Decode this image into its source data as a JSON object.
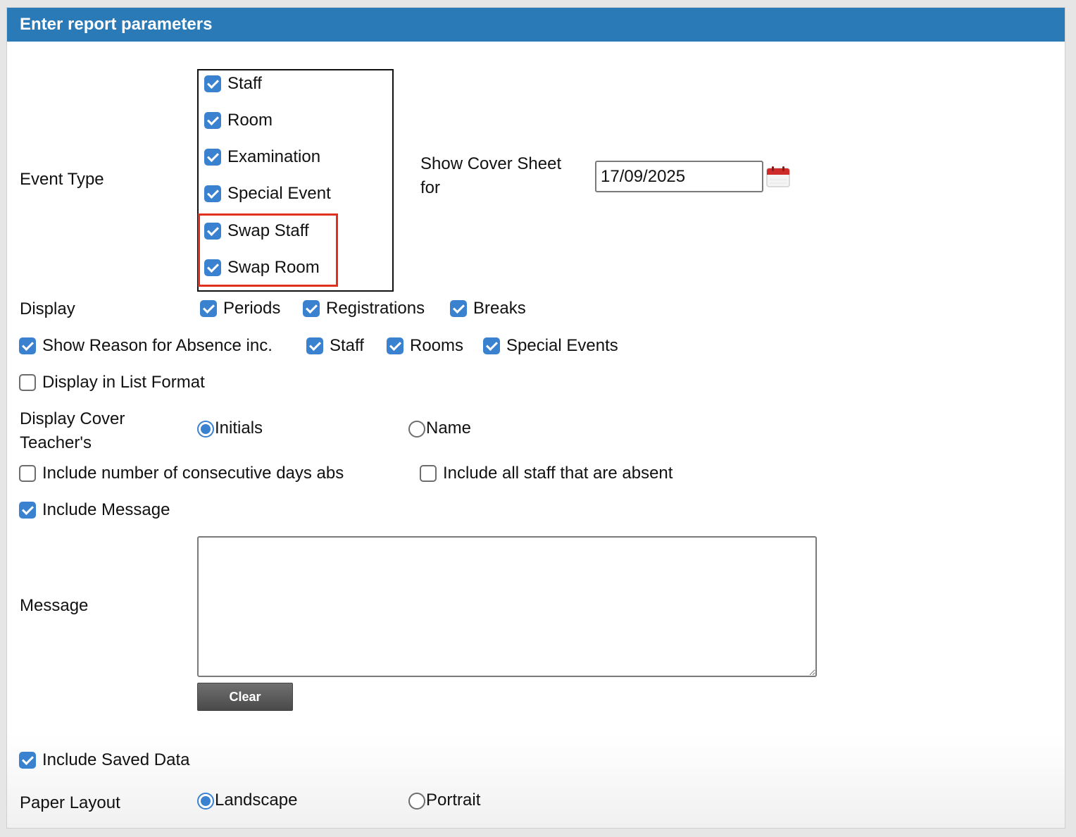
{
  "header": {
    "title": "Enter report parameters"
  },
  "event_type": {
    "label": "Event Type",
    "options": [
      {
        "label": "Staff",
        "checked": true
      },
      {
        "label": "Room",
        "checked": true
      },
      {
        "label": "Examination",
        "checked": true
      },
      {
        "label": "Special Event",
        "checked": true
      },
      {
        "label": "Swap Staff",
        "checked": true
      },
      {
        "label": "Swap Room",
        "checked": true
      }
    ]
  },
  "cover_sheet": {
    "label": "Show Cover Sheet for",
    "label_line1": "Show Cover Sheet",
    "label_line2": "for",
    "date": "17/09/2025"
  },
  "display": {
    "label": "Display",
    "options": [
      {
        "label": "Periods",
        "checked": true
      },
      {
        "label": "Registrations",
        "checked": true
      },
      {
        "label": "Breaks",
        "checked": true
      }
    ]
  },
  "absence": {
    "label": "Show Reason for Absence inc.",
    "checked": true,
    "options": [
      {
        "label": "Staff",
        "checked": true
      },
      {
        "label": "Rooms",
        "checked": true
      },
      {
        "label": "Special Events",
        "checked": true
      }
    ]
  },
  "list_format": {
    "label": "Display in List Format",
    "checked": false
  },
  "cover_teacher": {
    "label_line1": "Display Cover",
    "label_line2": "Teacher's",
    "options": [
      {
        "label": "Initials",
        "selected": true
      },
      {
        "label": "Name",
        "selected": false
      }
    ]
  },
  "consecutive_days": {
    "label": "Include number of consecutive days abs",
    "checked": false
  },
  "all_absent": {
    "label": "Include all staff that are absent",
    "checked": false
  },
  "include_message": {
    "label": "Include Message",
    "checked": true
  },
  "message": {
    "label": "Message",
    "value": ""
  },
  "clear_button": {
    "label": "Clear"
  },
  "saved_data": {
    "label": "Include Saved Data",
    "checked": true
  },
  "paper_layout": {
    "label": "Paper Layout",
    "options": [
      {
        "label": "Landscape",
        "selected": true
      },
      {
        "label": "Portrait",
        "selected": false
      }
    ]
  },
  "colors": {
    "header": "#2a7ab8",
    "accent": "#3a82cf",
    "highlight": "#e0301e"
  }
}
